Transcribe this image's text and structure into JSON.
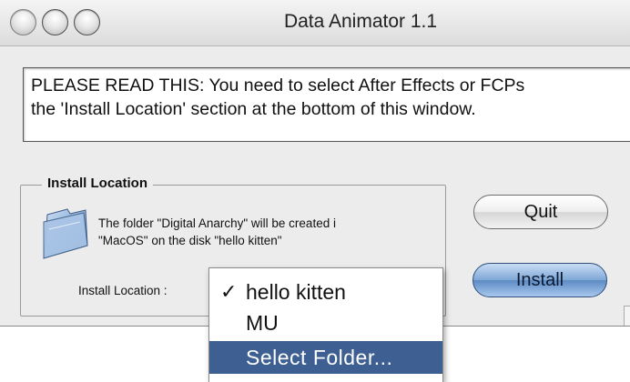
{
  "window": {
    "title": "Data Animator 1.1"
  },
  "readme": {
    "text": "PLEASE READ THIS: You need to select After Effects or FCPs\nthe 'Install Location' section at the bottom of this window."
  },
  "install_location": {
    "group_title": "Install Location",
    "description": "The folder \"Digital Anarchy\" will be created i\n\"MacOS\" on the disk \"hello kitten\"",
    "field_label": "Install Location :"
  },
  "buttons": {
    "quit": "Quit",
    "install": "Install"
  },
  "popup_menu": {
    "items": [
      {
        "label": "hello kitten",
        "checked": true,
        "check_glyph": "✓"
      },
      {
        "label": "MU",
        "checked": false
      },
      {
        "label": "Select Folder...",
        "highlighted": true
      }
    ]
  },
  "colors": {
    "window_bg": "#ececec",
    "menu_highlight": "#3d5f92",
    "default_button": "#7fa7d6"
  },
  "icons": [
    "folder-icon",
    "checkmark-icon"
  ]
}
